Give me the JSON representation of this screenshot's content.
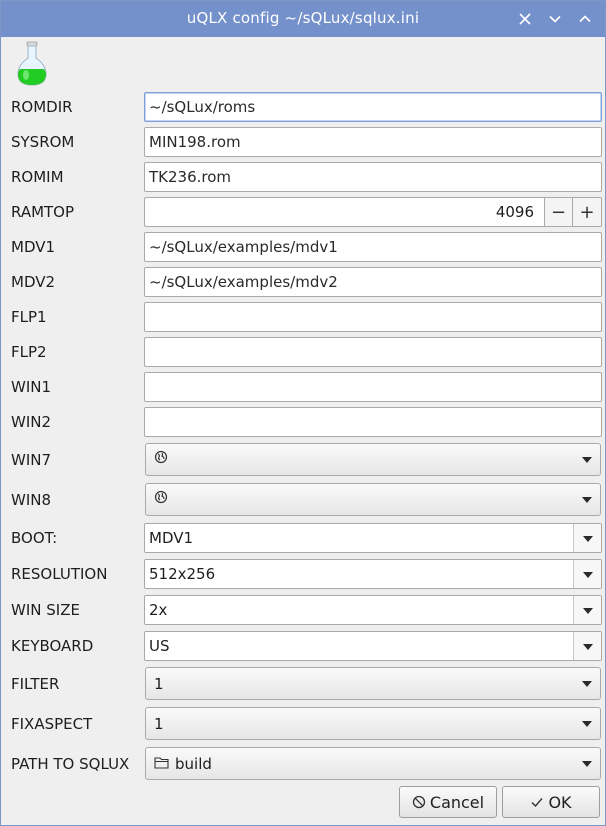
{
  "window": {
    "title": "uQLX config ~/sQLux/sqlux.ini",
    "controls": [
      "close-icon",
      "minimize-icon",
      "maximize-icon"
    ]
  },
  "fields": {
    "romdir": {
      "label": "ROMDIR",
      "value": "~/sQLux/roms"
    },
    "sysrom": {
      "label": "SYSROM",
      "value": "MIN198.rom"
    },
    "romim": {
      "label": "ROMIM",
      "value": "TK236.rom"
    },
    "ramtop": {
      "label": "RAMTOP",
      "value": "4096",
      "decrement": "−",
      "increment": "+"
    },
    "mdv1": {
      "label": "MDV1",
      "value": "~/sQLux/examples/mdv1"
    },
    "mdv2": {
      "label": "MDV2",
      "value": "~/sQLux/examples/mdv2"
    },
    "flp1": {
      "label": "FLP1",
      "value": ""
    },
    "flp2": {
      "label": "FLP2",
      "value": ""
    },
    "win1": {
      "label": "WIN1",
      "value": ""
    },
    "win2": {
      "label": "WIN2",
      "value": ""
    },
    "win7": {
      "label": "WIN7",
      "value": ""
    },
    "win8": {
      "label": "WIN8",
      "value": ""
    },
    "boot": {
      "label": "BOOT:",
      "value": "MDV1"
    },
    "resolution": {
      "label": "RESOLUTION",
      "value": "512x256"
    },
    "win_size": {
      "label": "WIN SIZE",
      "value": "2x"
    },
    "keyboard": {
      "label": "KEYBOARD",
      "value": "US"
    },
    "filter": {
      "label": "FILTER",
      "value": "1"
    },
    "fixaspect": {
      "label": "FIXASPECT",
      "value": "1"
    },
    "path_to_sqlux": {
      "label": "PATH TO SQLUX",
      "value": "build"
    }
  },
  "buttons": {
    "cancel": "Cancel",
    "ok": "OK"
  },
  "colors": {
    "titlebar": "#7591cc",
    "flask_liquid": "#22cc22"
  }
}
